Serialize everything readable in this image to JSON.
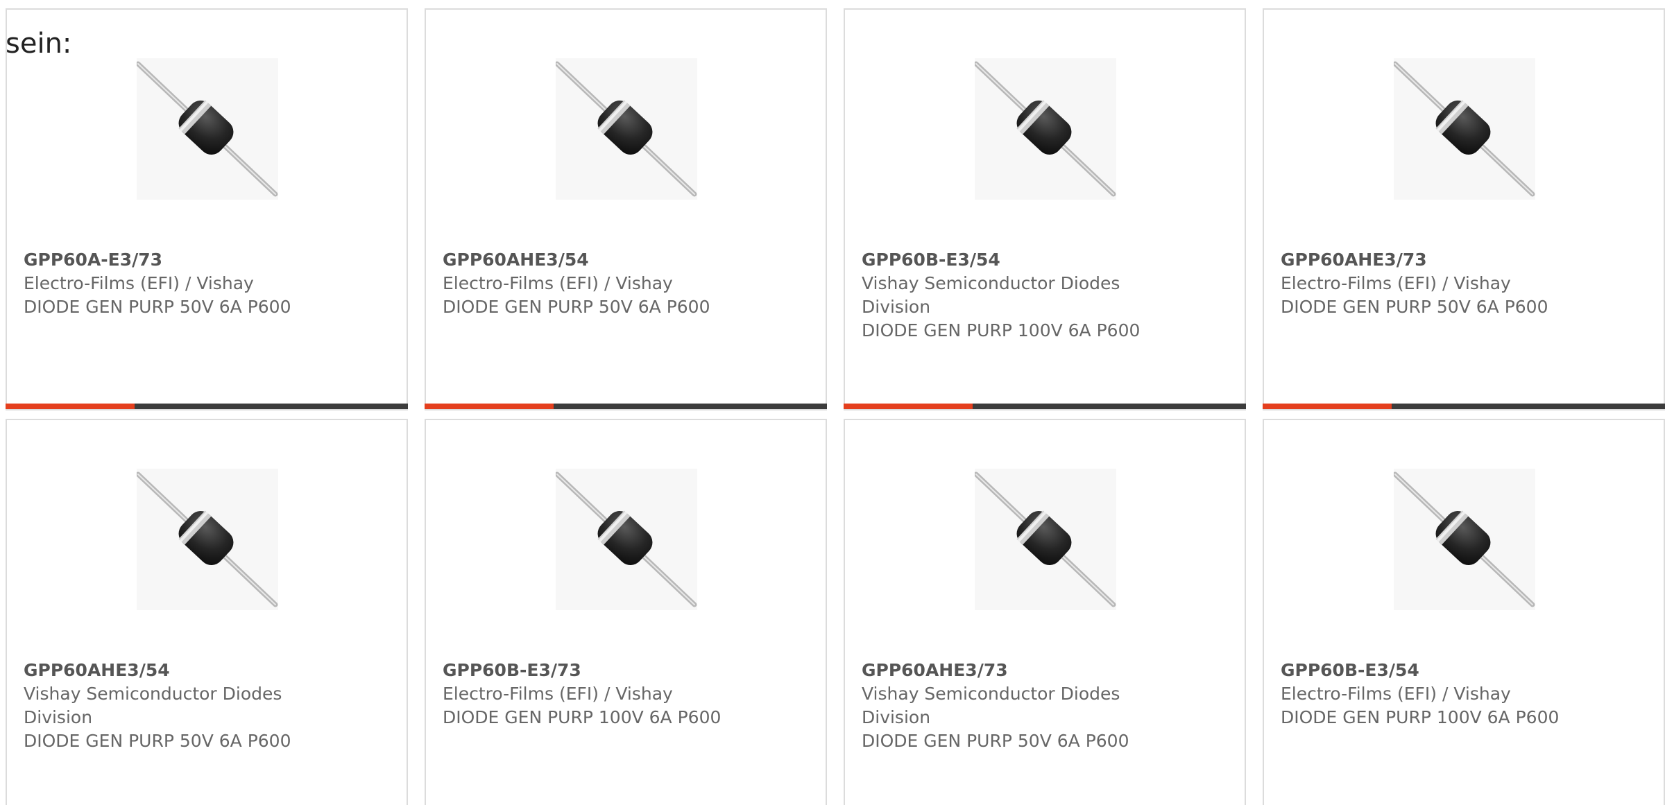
{
  "intro_text": "sein:",
  "colors": {
    "accent": "#e43f1e",
    "bar_track": "#3c3c3c",
    "card_border": "#dcdcdc",
    "text_muted": "#666666"
  },
  "products": [
    {
      "part": "GPP60A-E3/73",
      "maker": "Electro-Films (EFI) / Vishay",
      "desc": "DIODE GEN PURP 50V 6A P600",
      "image_icon": "axial-diode-icon",
      "progress": 0.32
    },
    {
      "part": "GPP60AHE3/54",
      "maker": "Electro-Films (EFI) / Vishay",
      "desc": "DIODE GEN PURP 50V 6A P600",
      "image_icon": "axial-diode-icon",
      "progress": 0.32
    },
    {
      "part": "GPP60B-E3/54",
      "maker": "Vishay Semiconductor Diodes Division",
      "desc": "DIODE GEN PURP 100V 6A P600",
      "image_icon": "axial-diode-icon",
      "progress": 0.32
    },
    {
      "part": "GPP60AHE3/73",
      "maker": "Electro-Films (EFI) / Vishay",
      "desc": "DIODE GEN PURP 50V 6A P600",
      "image_icon": "axial-diode-icon",
      "progress": 0.32
    },
    {
      "part": "GPP60AHE3/54",
      "maker": "Vishay Semiconductor Diodes Division",
      "desc": "DIODE GEN PURP 50V 6A P600",
      "image_icon": "axial-diode-icon"
    },
    {
      "part": "GPP60B-E3/73",
      "maker": "Electro-Films (EFI) / Vishay",
      "desc": "DIODE GEN PURP 100V 6A P600",
      "image_icon": "axial-diode-icon"
    },
    {
      "part": "GPP60AHE3/73",
      "maker": "Vishay Semiconductor Diodes Division",
      "desc": "DIODE GEN PURP 50V 6A P600",
      "image_icon": "axial-diode-icon"
    },
    {
      "part": "GPP60B-E3/54",
      "maker": "Electro-Films (EFI) / Vishay",
      "desc": "DIODE GEN PURP 100V 6A P600",
      "image_icon": "axial-diode-icon"
    }
  ]
}
